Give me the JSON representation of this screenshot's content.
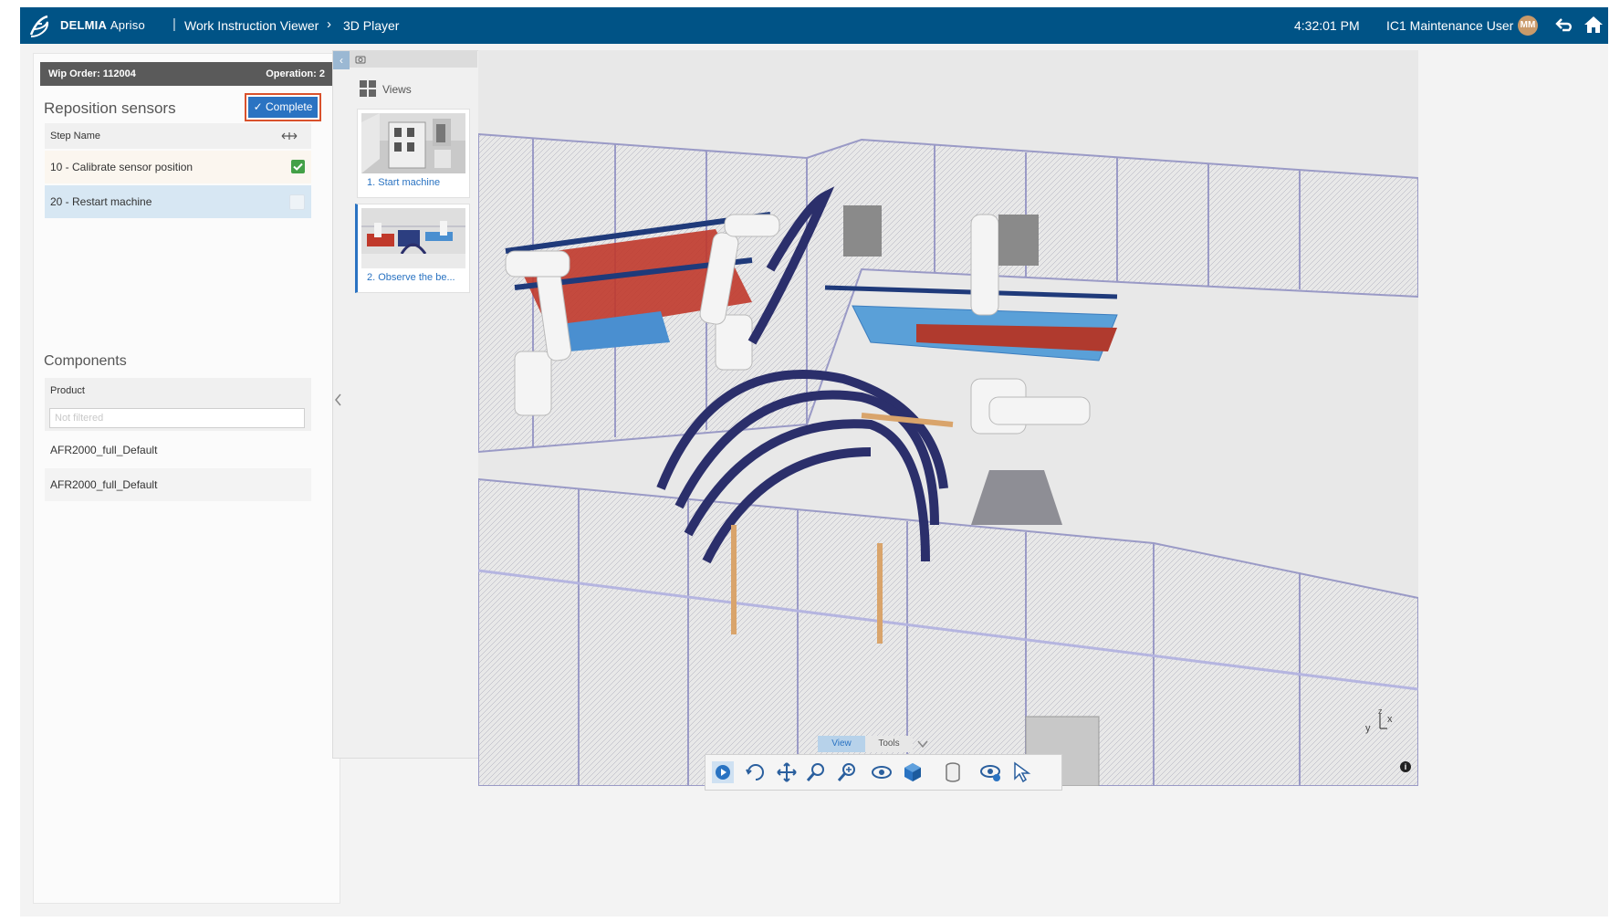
{
  "app": {
    "brand_bold": "DELMIA",
    "brand_light": "Apriso",
    "breadcrumb_separator": "|",
    "breadcrumb": [
      "Work Instruction Viewer",
      "3D Player"
    ],
    "breadcrumb_chevron": "›",
    "time": "4:32:01 PM",
    "user": "IC1 Maintenance User",
    "user_initials": "MM",
    "header_color": "#005386"
  },
  "left_panel": {
    "wip_order": "Wip Order: 112004",
    "operation": "Operation: 2",
    "task_title": "Reposition sensors",
    "complete_label": "Complete",
    "steps_header": "Step Name",
    "steps": [
      {
        "name": "10 - Calibrate sensor position",
        "checked": true
      },
      {
        "name": "20 - Restart machine",
        "checked": false
      }
    ],
    "components_title": "Components",
    "components_header": "Product",
    "filter_placeholder": "Not filtered",
    "components": [
      "AFR2000_full_Default",
      "AFR2000_full_Default"
    ]
  },
  "views_panel": {
    "title": "Views",
    "views": [
      {
        "label": "1. Start machine",
        "selected": false
      },
      {
        "label": "2. Observe the be...",
        "selected": true
      }
    ]
  },
  "viewer": {
    "tabs": [
      "View",
      "Tools"
    ],
    "active_tab": "View",
    "toolbar_icons": [
      "play-icon",
      "rotate-icon",
      "pan-icon",
      "zoom-icon",
      "zoom-area-icon",
      "look-icon",
      "view-cube-icon",
      "cylinder-icon",
      "visibility-icon",
      "select-icon"
    ],
    "axis_labels": {
      "y": "y",
      "x": "x",
      "z": "z"
    }
  }
}
